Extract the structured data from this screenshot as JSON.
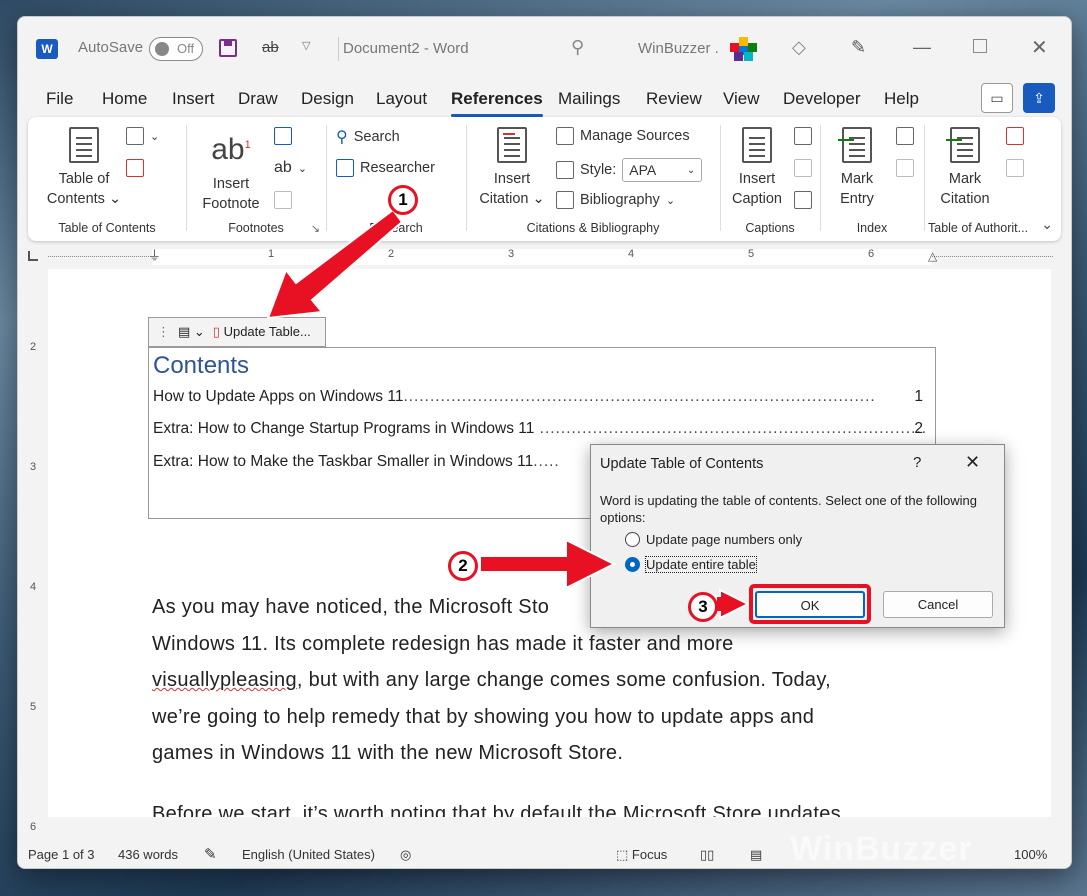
{
  "window": {
    "app_initial": "W",
    "autosave_label": "AutoSave",
    "autosave_state": "Off",
    "undo_symbol": "ab",
    "doc_title": "Document2  -  Word",
    "user_name": "WinBuzzer ."
  },
  "menu": {
    "items": [
      "File",
      "Home",
      "Insert",
      "Draw",
      "Design",
      "Layout",
      "References",
      "Mailings",
      "Review",
      "View",
      "Developer",
      "Help"
    ],
    "active": "References"
  },
  "ribbon": {
    "toc_group": {
      "button": "Table of",
      "button2": "Contents",
      "label": "Table of Contents"
    },
    "footnotes_group": {
      "icon_text": "ab",
      "superscript": "1",
      "button": "Insert",
      "button2": "Footnote",
      "label": "Footnotes"
    },
    "research_group": {
      "search": "Search",
      "researcher": "Researcher",
      "label": "Research"
    },
    "citations_group": {
      "insert": "Insert",
      "insert2": "Citation",
      "manage": "Manage Sources",
      "style_label": "Style:",
      "style_value": "APA",
      "bibliography": "Bibliography",
      "label": "Citations & Bibliography"
    },
    "captions_group": {
      "button": "Insert",
      "button2": "Caption",
      "label": "Captions"
    },
    "index_group": {
      "button": "Mark",
      "button2": "Entry",
      "label": "Index"
    },
    "authorities_group": {
      "button": "Mark",
      "button2": "Citation",
      "label": "Table of Authorit..."
    }
  },
  "ruler": {
    "h_numbers": [
      "1",
      "2",
      "3",
      "4",
      "5",
      "6"
    ],
    "v_numbers": [
      "2",
      "3",
      "4",
      "5",
      "6"
    ]
  },
  "document": {
    "toc_toolbar_label": "Update Table...",
    "toc_title": "Contents",
    "toc_entries": [
      {
        "text": "How to Update Apps on Windows 11",
        "dots": ".........................................................................................",
        "page": "1"
      },
      {
        "text": "Extra: How to Change Startup Programs in Windows 11",
        "dots": " .........................................................................",
        "page": "2"
      },
      {
        "text": "Extra: How to Make the Taskbar Smaller in Windows 11",
        "dots": ".....",
        "page": ""
      }
    ],
    "para1": {
      "line1": "As you may have noticed, the Microsoft Sto",
      "line2": "Windows 11. Its complete redesign has made it faster and more",
      "line3_err": "visuallypleasing",
      "line3_rest": ", but with any large change comes some confusion. Today,",
      "line4": "we’re going to help remedy that by showing you how to update apps and",
      "line5": "games in Windows 11 with the new Microsoft Store."
    },
    "para2": "Before we start, it’s worth noting that by default the Microsoft Store updates"
  },
  "dialog": {
    "title": "Update Table of Contents",
    "help": "?",
    "close": "✕",
    "message": "Word is updating the table of contents.  Select one of the following options:",
    "option1": "Update page numbers only",
    "option2": "Update entire table",
    "selected": "option2",
    "ok": "OK",
    "cancel": "Cancel"
  },
  "annotations": {
    "step1": "1",
    "step2": "2",
    "step3": "3",
    "color": "#e81123"
  },
  "status": {
    "page": "Page 1 of 3",
    "words": "436 words",
    "language": "English (United States)",
    "focus": "Focus",
    "zoom": "100%"
  },
  "watermark": "WinBuzzer",
  "colors": {
    "accent": "#185abd",
    "heading": "#2f5496",
    "annotation": "#e81123"
  }
}
